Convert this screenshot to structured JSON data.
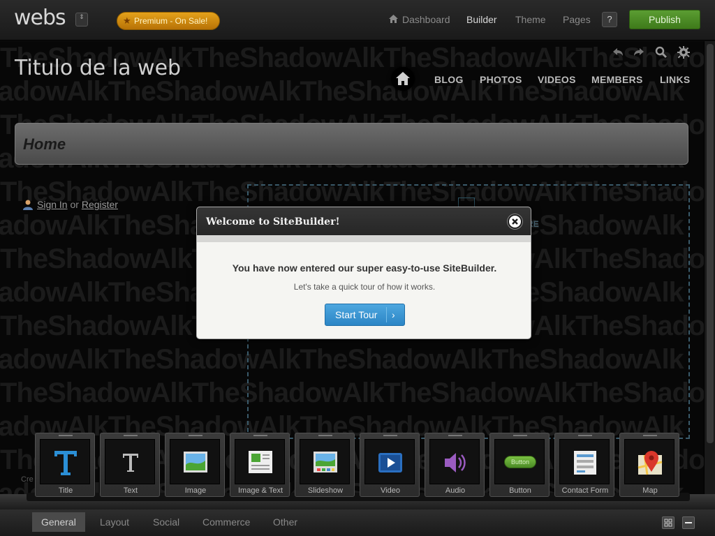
{
  "topbar": {
    "logo": "webs",
    "logo_toggle": "⇕",
    "premium_label": "Premium - On Sale!",
    "nav": {
      "dashboard": "Dashboard",
      "builder": "Builder",
      "theme": "Theme",
      "pages": "Pages"
    },
    "help_label": "?",
    "publish_label": "Publish"
  },
  "site": {
    "title": "Titulo de la web",
    "nav": [
      "BLOG",
      "PHOTOS",
      "VIDEOS",
      "MEMBERS",
      "LINKS"
    ],
    "page_heading": "Home",
    "signin": "Sign In",
    "or": "or",
    "register": "Register",
    "drop_zone_label": "RE",
    "footer_text": "Cre",
    "watermark_text": "TheShadowAlkTheShadowAlkTheShadowAlkTheShadowAlk"
  },
  "widgets": [
    {
      "label": "Title",
      "icon": "title-icon"
    },
    {
      "label": "Text",
      "icon": "text-icon"
    },
    {
      "label": "Image",
      "icon": "image-icon"
    },
    {
      "label": "Image & Text",
      "icon": "image-text-icon"
    },
    {
      "label": "Slideshow",
      "icon": "slideshow-icon"
    },
    {
      "label": "Video",
      "icon": "video-icon"
    },
    {
      "label": "Audio",
      "icon": "audio-icon"
    },
    {
      "label": "Button",
      "icon": "button-icon",
      "button_text": "Button"
    },
    {
      "label": "Contact Form",
      "icon": "contact-form-icon"
    },
    {
      "label": "Map",
      "icon": "map-icon"
    }
  ],
  "bottom_tabs": [
    "General",
    "Layout",
    "Social",
    "Commerce",
    "Other"
  ],
  "modal": {
    "title": "Welcome to SiteBuilder!",
    "heading": "You have now entered our super easy-to-use SiteBuilder.",
    "subtext": "Let's take a quick tour of how it works.",
    "button_label": "Start Tour",
    "button_arrow": "›"
  },
  "colors": {
    "publish": "#4a8a25",
    "premium": "#d08d12",
    "start_tour": "#3796d4",
    "drop_zone_border": "#3a5a6a"
  }
}
